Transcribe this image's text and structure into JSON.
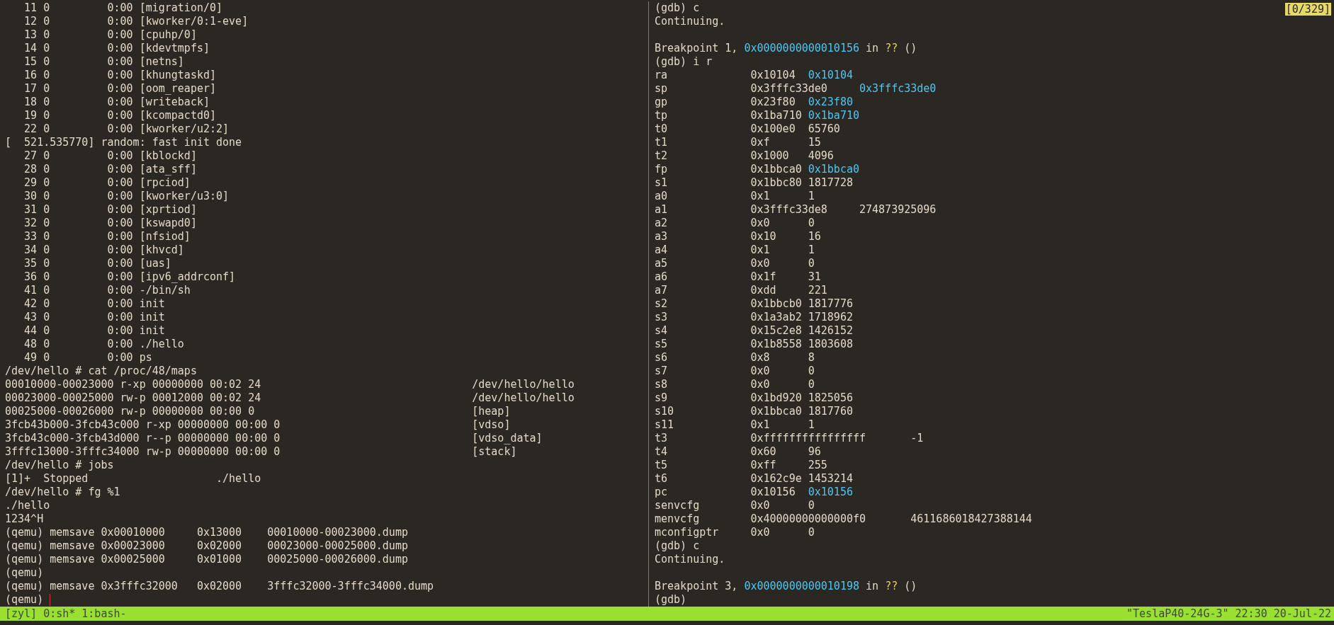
{
  "left_pane": {
    "lines": [
      "   11 0         0:00 [migration/0]",
      "   12 0         0:00 [kworker/0:1-eve]",
      "   13 0         0:00 [cpuhp/0]",
      "   14 0         0:00 [kdevtmpfs]",
      "   15 0         0:00 [netns]",
      "   16 0         0:00 [khungtaskd]",
      "   17 0         0:00 [oom_reaper]",
      "   18 0         0:00 [writeback]",
      "   19 0         0:00 [kcompactd0]",
      "   22 0         0:00 [kworker/u2:2]",
      "[  521.535770] random: fast init done",
      "   27 0         0:00 [kblockd]",
      "   28 0         0:00 [ata_sff]",
      "   29 0         0:00 [rpciod]",
      "   30 0         0:00 [kworker/u3:0]",
      "   31 0         0:00 [xprtiod]",
      "   32 0         0:00 [kswapd0]",
      "   33 0         0:00 [nfsiod]",
      "   34 0         0:00 [khvcd]",
      "   35 0         0:00 [uas]",
      "   36 0         0:00 [ipv6_addrconf]",
      "   41 0         0:00 -/bin/sh",
      "   42 0         0:00 init",
      "   43 0         0:00 init",
      "   44 0         0:00 init",
      "   48 0         0:00 ./hello",
      "   49 0         0:00 ps",
      "/dev/hello # cat /proc/48/maps",
      "00010000-00023000 r-xp 00000000 00:02 24                                 /dev/hello/hello",
      "00023000-00025000 rw-p 00012000 00:02 24                                 /dev/hello/hello",
      "00025000-00026000 rw-p 00000000 00:00 0                                  [heap]",
      "3fcb43b000-3fcb43c000 r-xp 00000000 00:00 0                              [vdso]",
      "3fcb43c000-3fcb43d000 r--p 00000000 00:00 0                              [vdso_data]",
      "3fffc13000-3fffc34000 rw-p 00000000 00:00 0                              [stack]",
      "/dev/hello # jobs",
      "[1]+  Stopped                    ./hello",
      "/dev/hello # fg %1",
      "./hello",
      "1234^H",
      "(qemu) memsave 0x00010000     0x13000    00010000-00023000.dump",
      "(qemu) memsave 0x00023000     0x02000    00023000-00025000.dump",
      "(qemu) memsave 0x00025000     0x01000    00025000-00026000.dump",
      "(qemu)",
      "(qemu) memsave 0x3fffc32000   0x02000    3fffc32000-3fffc34000.dump",
      "(qemu)"
    ],
    "cursor": true
  },
  "right_pane": {
    "position_indicator": "[0/329]",
    "lines": [
      {
        "kind": "text",
        "segments": [
          {
            "text": "(gdb) c",
            "kind": "plain"
          }
        ]
      },
      {
        "kind": "text",
        "segments": [
          {
            "text": "Continuing.",
            "kind": "plain"
          }
        ]
      },
      {
        "kind": "blank"
      },
      {
        "kind": "text",
        "segments": [
          {
            "text": "Breakpoint 1, ",
            "kind": "plain"
          },
          {
            "text": "0x0000000000010156",
            "kind": "address"
          },
          {
            "text": " in ",
            "kind": "plain"
          },
          {
            "text": "??",
            "kind": "unknown"
          },
          {
            "text": " ()",
            "kind": "plain"
          }
        ]
      },
      {
        "kind": "text",
        "segments": [
          {
            "text": "(gdb) i r",
            "kind": "plain"
          }
        ]
      },
      {
        "kind": "text",
        "segments": [
          {
            "text": "ra             0x10104  ",
            "kind": "plain"
          },
          {
            "text": "0x10104",
            "kind": "address"
          }
        ]
      },
      {
        "kind": "text",
        "segments": [
          {
            "text": "sp             0x3fffc33de0     ",
            "kind": "plain"
          },
          {
            "text": "0x3fffc33de0",
            "kind": "address"
          }
        ]
      },
      {
        "kind": "text",
        "segments": [
          {
            "text": "gp             0x23f80  ",
            "kind": "plain"
          },
          {
            "text": "0x23f80",
            "kind": "address"
          }
        ]
      },
      {
        "kind": "text",
        "segments": [
          {
            "text": "tp             0x1ba710 ",
            "kind": "plain"
          },
          {
            "text": "0x1ba710",
            "kind": "address"
          }
        ]
      },
      {
        "kind": "text",
        "segments": [
          {
            "text": "t0             0x100e0  65760",
            "kind": "plain"
          }
        ]
      },
      {
        "kind": "text",
        "segments": [
          {
            "text": "t1             0xf      15",
            "kind": "plain"
          }
        ]
      },
      {
        "kind": "text",
        "segments": [
          {
            "text": "t2             0x1000   4096",
            "kind": "plain"
          }
        ]
      },
      {
        "kind": "text",
        "segments": [
          {
            "text": "fp             0x1bbca0 ",
            "kind": "plain"
          },
          {
            "text": "0x1bbca0",
            "kind": "address"
          }
        ]
      },
      {
        "kind": "text",
        "segments": [
          {
            "text": "s1             0x1bbc80 1817728",
            "kind": "plain"
          }
        ]
      },
      {
        "kind": "text",
        "segments": [
          {
            "text": "a0             0x1      1",
            "kind": "plain"
          }
        ]
      },
      {
        "kind": "text",
        "segments": [
          {
            "text": "a1             0x3fffc33de8     274873925096",
            "kind": "plain"
          }
        ]
      },
      {
        "kind": "text",
        "segments": [
          {
            "text": "a2             0x0      0",
            "kind": "plain"
          }
        ]
      },
      {
        "kind": "text",
        "segments": [
          {
            "text": "a3             0x10     16",
            "kind": "plain"
          }
        ]
      },
      {
        "kind": "text",
        "segments": [
          {
            "text": "a4             0x1      1",
            "kind": "plain"
          }
        ]
      },
      {
        "kind": "text",
        "segments": [
          {
            "text": "a5             0x0      0",
            "kind": "plain"
          }
        ]
      },
      {
        "kind": "text",
        "segments": [
          {
            "text": "a6             0x1f     31",
            "kind": "plain"
          }
        ]
      },
      {
        "kind": "text",
        "segments": [
          {
            "text": "a7             0xdd     221",
            "kind": "plain"
          }
        ]
      },
      {
        "kind": "text",
        "segments": [
          {
            "text": "s2             0x1bbcb0 1817776",
            "kind": "plain"
          }
        ]
      },
      {
        "kind": "text",
        "segments": [
          {
            "text": "s3             0x1a3ab2 1718962",
            "kind": "plain"
          }
        ]
      },
      {
        "kind": "text",
        "segments": [
          {
            "text": "s4             0x15c2e8 1426152",
            "kind": "plain"
          }
        ]
      },
      {
        "kind": "text",
        "segments": [
          {
            "text": "s5             0x1b8558 1803608",
            "kind": "plain"
          }
        ]
      },
      {
        "kind": "text",
        "segments": [
          {
            "text": "s6             0x8      8",
            "kind": "plain"
          }
        ]
      },
      {
        "kind": "text",
        "segments": [
          {
            "text": "s7             0x0      0",
            "kind": "plain"
          }
        ]
      },
      {
        "kind": "text",
        "segments": [
          {
            "text": "s8             0x0      0",
            "kind": "plain"
          }
        ]
      },
      {
        "kind": "text",
        "segments": [
          {
            "text": "s9             0x1bd920 1825056",
            "kind": "plain"
          }
        ]
      },
      {
        "kind": "text",
        "segments": [
          {
            "text": "s10            0x1bbca0 1817760",
            "kind": "plain"
          }
        ]
      },
      {
        "kind": "text",
        "segments": [
          {
            "text": "s11            0x1      1",
            "kind": "plain"
          }
        ]
      },
      {
        "kind": "text",
        "segments": [
          {
            "text": "t3             0xffffffffffffffff       -1",
            "kind": "plain"
          }
        ]
      },
      {
        "kind": "text",
        "segments": [
          {
            "text": "t4             0x60     96",
            "kind": "plain"
          }
        ]
      },
      {
        "kind": "text",
        "segments": [
          {
            "text": "t5             0xff     255",
            "kind": "plain"
          }
        ]
      },
      {
        "kind": "text",
        "segments": [
          {
            "text": "t6             0x162c9e 1453214",
            "kind": "plain"
          }
        ]
      },
      {
        "kind": "text",
        "segments": [
          {
            "text": "pc             0x10156  ",
            "kind": "plain"
          },
          {
            "text": "0x10156",
            "kind": "address"
          }
        ]
      },
      {
        "kind": "text",
        "segments": [
          {
            "text": "senvcfg        0x0      0",
            "kind": "plain"
          }
        ]
      },
      {
        "kind": "text",
        "segments": [
          {
            "text": "menvcfg        0x40000000000000f0       4611686018427388144",
            "kind": "plain"
          }
        ]
      },
      {
        "kind": "text",
        "segments": [
          {
            "text": "mconfigptr     0x0      0",
            "kind": "plain"
          }
        ]
      },
      {
        "kind": "text",
        "segments": [
          {
            "text": "(gdb) c",
            "kind": "plain"
          }
        ]
      },
      {
        "kind": "text",
        "segments": [
          {
            "text": "Continuing.",
            "kind": "plain"
          }
        ]
      },
      {
        "kind": "blank"
      },
      {
        "kind": "text",
        "segments": [
          {
            "text": "Breakpoint 3, ",
            "kind": "plain"
          },
          {
            "text": "0x0000000000010198",
            "kind": "address"
          },
          {
            "text": " in ",
            "kind": "plain"
          },
          {
            "text": "??",
            "kind": "unknown"
          },
          {
            "text": " ()",
            "kind": "plain"
          }
        ]
      },
      {
        "kind": "text",
        "segments": [
          {
            "text": "(gdb)",
            "kind": "plain"
          }
        ]
      }
    ]
  },
  "status_bar": {
    "session": "[zyl]",
    "windows": [
      "0:sh*",
      "1:bash-"
    ],
    "right": "\"TeslaP40-24G-3\" 22:30 20-Jul-22"
  }
}
